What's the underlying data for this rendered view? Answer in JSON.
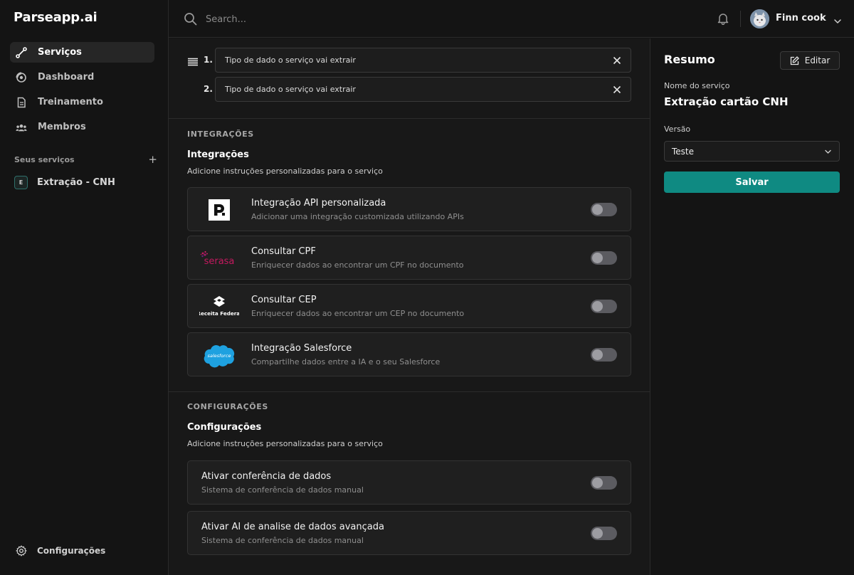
{
  "app": {
    "logo": "Parseapp.ai"
  },
  "sidebar": {
    "nav": [
      {
        "label": "Serviços",
        "icon": "route-icon",
        "active": true
      },
      {
        "label": "Dashboard",
        "icon": "dashboard-icon",
        "active": false
      },
      {
        "label": "Treinamento",
        "icon": "document-icon",
        "active": false
      },
      {
        "label": "Membros",
        "icon": "users-icon",
        "active": false
      }
    ],
    "services_label": "Seus serviços",
    "add_symbol": "+",
    "services": [
      {
        "badge": "E",
        "label": "Extração - CNH"
      }
    ],
    "settings_label": "Configurações"
  },
  "topbar": {
    "search_placeholder": "Search...",
    "user_name": "Finn cook"
  },
  "main": {
    "fields": [
      {
        "number": "1.",
        "text": "Tipo de dado o serviço vai extrair"
      },
      {
        "number": "2.",
        "text": "Tipo de dado o serviço vai extrair"
      }
    ],
    "integrations": {
      "caption": "INTEGRAÇÕES",
      "title": "Integrações",
      "description": "Adicione instruções personalizadas para o serviço",
      "items": [
        {
          "title": "Integração API personalizada",
          "description": "Adicionar uma integração customizada utilizando APIs",
          "logo": "parse-logo",
          "enabled": false
        },
        {
          "title": "Consultar CPF",
          "description": "Enriquecer dados ao encontrar um CPF no documento",
          "logo": "serasa-logo",
          "logo_text": "serasa",
          "enabled": false
        },
        {
          "title": "Consultar CEP",
          "description": "Enriquecer dados ao encontrar um CEP no documento",
          "logo": "receita-federal-logo",
          "logo_text": "Receita Federal",
          "enabled": false
        },
        {
          "title": "Integração Salesforce",
          "description": "Compartilhe dados entre a IA e o seu Salesforce",
          "logo": "salesforce-logo",
          "logo_text": "salesforce",
          "enabled": false
        }
      ]
    },
    "configurations": {
      "caption": "CONFIGURAÇÕES",
      "title": "Configurações",
      "description": "Adicione instruções personalizadas para o serviço",
      "items": [
        {
          "title": "Ativar conferência de dados",
          "description": "Sistema de conferência de dados manual",
          "enabled": false
        },
        {
          "title": "Ativar AI de analise de dados avançada",
          "description": "Sistema de conferência de dados manual",
          "enabled": false
        }
      ]
    }
  },
  "summary": {
    "title": "Resumo",
    "edit_label": "Editar",
    "service_name_label": "Nome do serviço",
    "service_name": "Extração cartão CNH",
    "version_label": "Versão",
    "version_value": "Teste",
    "save_label": "Salvar"
  },
  "colors": {
    "accent": "#0f8a82",
    "background": "#141414",
    "panel": "#181818"
  }
}
